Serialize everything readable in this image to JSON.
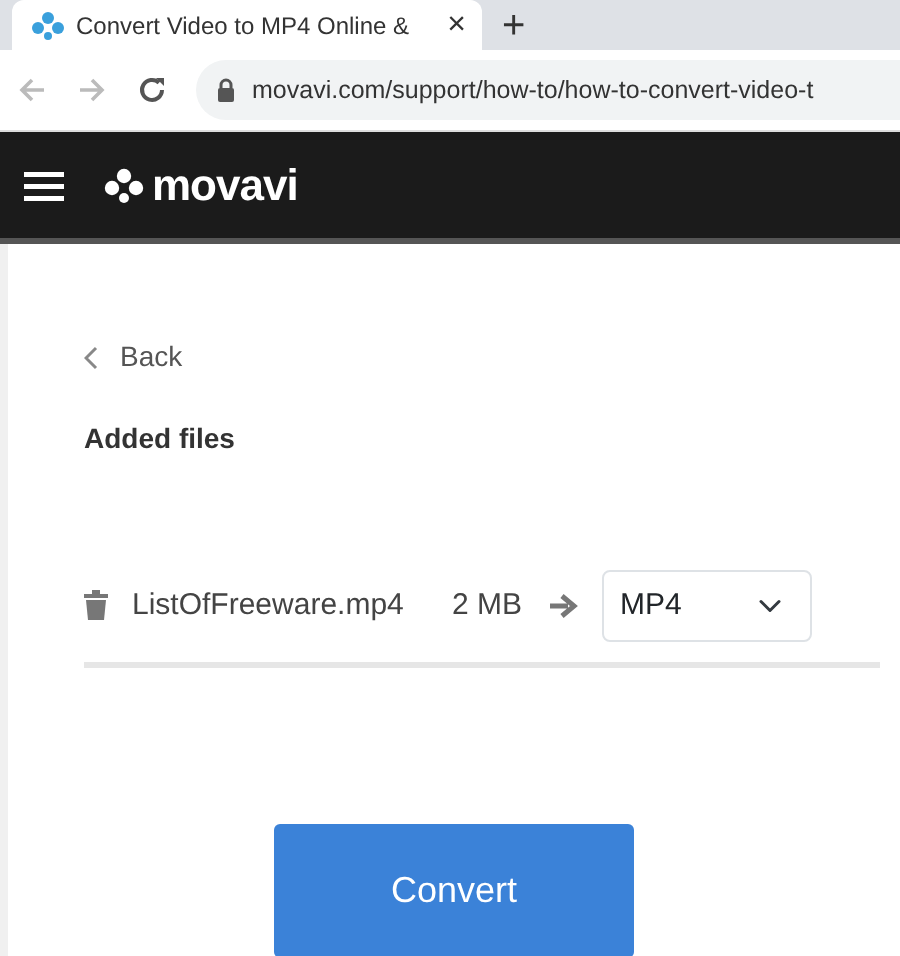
{
  "browser": {
    "tab_title": "Convert Video to MP4 Online &",
    "close": "×",
    "new_tab": "+",
    "url": "movavi.com/support/how-to/how-to-convert-video-t"
  },
  "header": {
    "logo": "movavi"
  },
  "back": "Back",
  "section_title": "Added files",
  "files": [
    {
      "name": "ListOfFreeware.mp4",
      "size": "2 MB",
      "format": "MP4"
    }
  ],
  "convert_button": "Convert"
}
